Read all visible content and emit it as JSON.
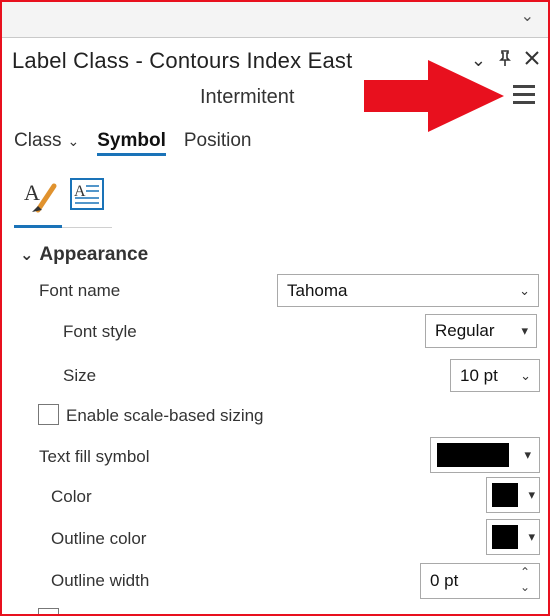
{
  "panel": {
    "title": "Label Class - Contours Index East",
    "subtitle": "Intermitent"
  },
  "tabs": [
    {
      "label": "Class",
      "has_dropdown": true
    },
    {
      "label": "Symbol",
      "active": true
    },
    {
      "label": "Position"
    }
  ],
  "section": {
    "label": "Appearance"
  },
  "fields": {
    "font_name": {
      "label": "Font name",
      "value": "Tahoma"
    },
    "font_style": {
      "label": "Font style",
      "value": "Regular"
    },
    "size": {
      "label": "Size",
      "value": "10 pt"
    },
    "scale_sizing": {
      "label": "Enable scale-based sizing",
      "checked": false
    },
    "text_fill": {
      "label": "Text fill symbol",
      "swatch": "#000000"
    },
    "color": {
      "label": "Color",
      "swatch": "#000000"
    },
    "outline_color": {
      "label": "Outline color",
      "swatch": "#000000"
    },
    "outline_width": {
      "label": "Outline width",
      "value": "0 pt"
    }
  },
  "colors": {
    "accent": "#1a73b8",
    "annotation": "#e8101e"
  }
}
